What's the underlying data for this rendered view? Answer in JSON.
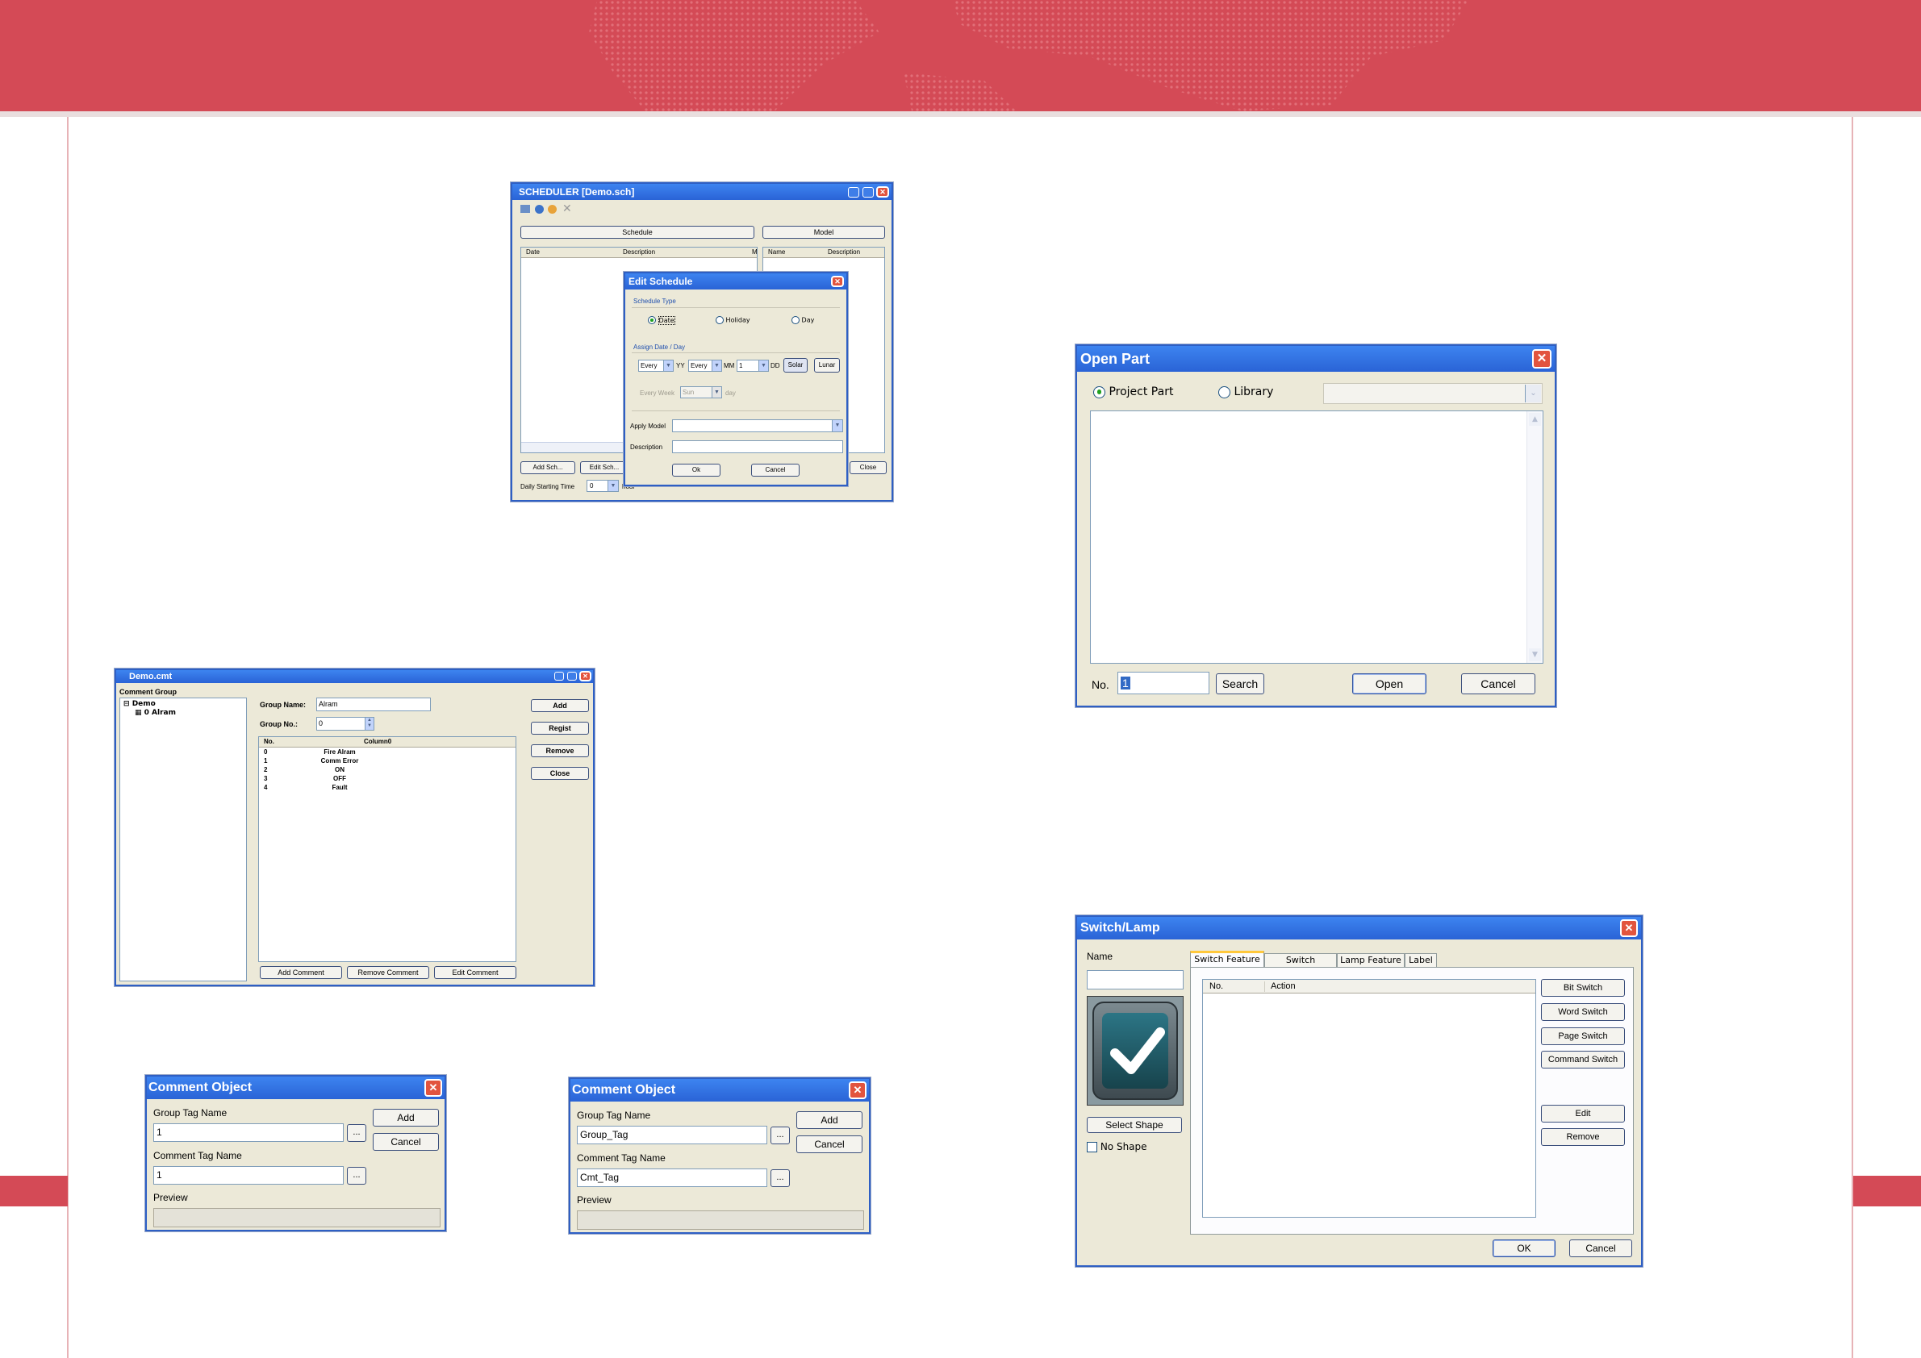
{
  "scheduler": {
    "title": "SCHEDULER [Demo.sch]",
    "tab_schedule": "Schedule",
    "tab_model": "Model",
    "col_date": "Date",
    "col_description": "Description",
    "col_m": "M",
    "col_name": "Name",
    "col_description2": "Description",
    "add_button": "Add Sch...",
    "edit_button": "Edit Sch...",
    "close_button": "Close",
    "daily_start_label": "Daily Starting Time",
    "daily_start_value": "0",
    "hour_label": "hour"
  },
  "edit_schedule": {
    "title": "Edit Schedule",
    "schedule_type_label": "Schedule Type",
    "radio_date": "Date",
    "radio_holiday": "Holiday",
    "radio_day": "Day",
    "assign_label": "Assign Date / Day",
    "yy_value": "Every",
    "yy_label": "YY",
    "mm_value": "Every",
    "mm_label": "MM",
    "dd_value": "1",
    "dd_label": "DD",
    "solar_button": "Solar",
    "lunar_button": "Lunar",
    "every_week_label": "Every Week",
    "week_value": "Sun",
    "day_label": "day",
    "apply_model_label": "Apply Model",
    "description_label": "Description",
    "ok_button": "Ok",
    "cancel_button": "Cancel"
  },
  "comment_window": {
    "title": "Demo.cmt",
    "group_heading": "Comment Group",
    "tree_root": "Demo",
    "tree_child": "0 Alram",
    "group_name_label": "Group Name:",
    "group_name_value": "Alram",
    "group_no_label": "Group No.:",
    "group_no_value": "0",
    "col_no": "No.",
    "col_column0": "Column0",
    "rows": [
      {
        "no": "0",
        "text": "Fire Alram"
      },
      {
        "no": "1",
        "text": "Comm Error"
      },
      {
        "no": "2",
        "text": "ON"
      },
      {
        "no": "3",
        "text": "OFF"
      },
      {
        "no": "4",
        "text": "Fault"
      }
    ],
    "add_button": "Add",
    "regist_button": "Regist",
    "remove_button": "Remove",
    "close_button": "Close",
    "add_comment_button": "Add Comment",
    "remove_comment_button": "Remove Comment",
    "edit_comment_button": "Edit Comment"
  },
  "comment_object_1": {
    "title": "Comment Object",
    "group_tag_label": "Group Tag Name",
    "group_tag_value": "1",
    "comment_tag_label": "Comment Tag Name",
    "comment_tag_value": "1",
    "preview_label": "Preview",
    "browse": "...",
    "add_button": "Add",
    "cancel_button": "Cancel"
  },
  "comment_object_2": {
    "title": "Comment Object",
    "group_tag_label": "Group Tag Name",
    "group_tag_value": "Group_Tag",
    "comment_tag_label": "Comment Tag Name",
    "comment_tag_value": "Cmt_Tag",
    "preview_label": "Preview",
    "browse": "...",
    "add_button": "Add",
    "cancel_button": "Cancel"
  },
  "open_part": {
    "title": "Open Part",
    "radio_project": "Project Part",
    "radio_library": "Library",
    "no_label": "No.",
    "no_value": "1",
    "search_button": "Search",
    "open_button": "Open",
    "cancel_button": "Cancel"
  },
  "switch_lamp": {
    "title": "Switch/Lamp",
    "name_label": "Name",
    "tabs": [
      "Switch Feature",
      "Switch Common",
      "Lamp Feature",
      "Label"
    ],
    "col_no": "No.",
    "col_action": "Action",
    "bit_switch": "Bit Switch",
    "word_switch": "Word Switch",
    "page_switch": "Page Switch",
    "command_switch": "Command Switch",
    "edit_button": "Edit",
    "remove_button": "Remove",
    "select_shape_button": "Select Shape",
    "no_shape_label": "No Shape",
    "ok_button": "OK",
    "cancel_button": "Cancel"
  },
  "colors": {
    "banner": "#d44a56",
    "titlebar": "#2a63d6",
    "dialog_bg": "#ece9d8",
    "close_red": "#e2543e"
  }
}
